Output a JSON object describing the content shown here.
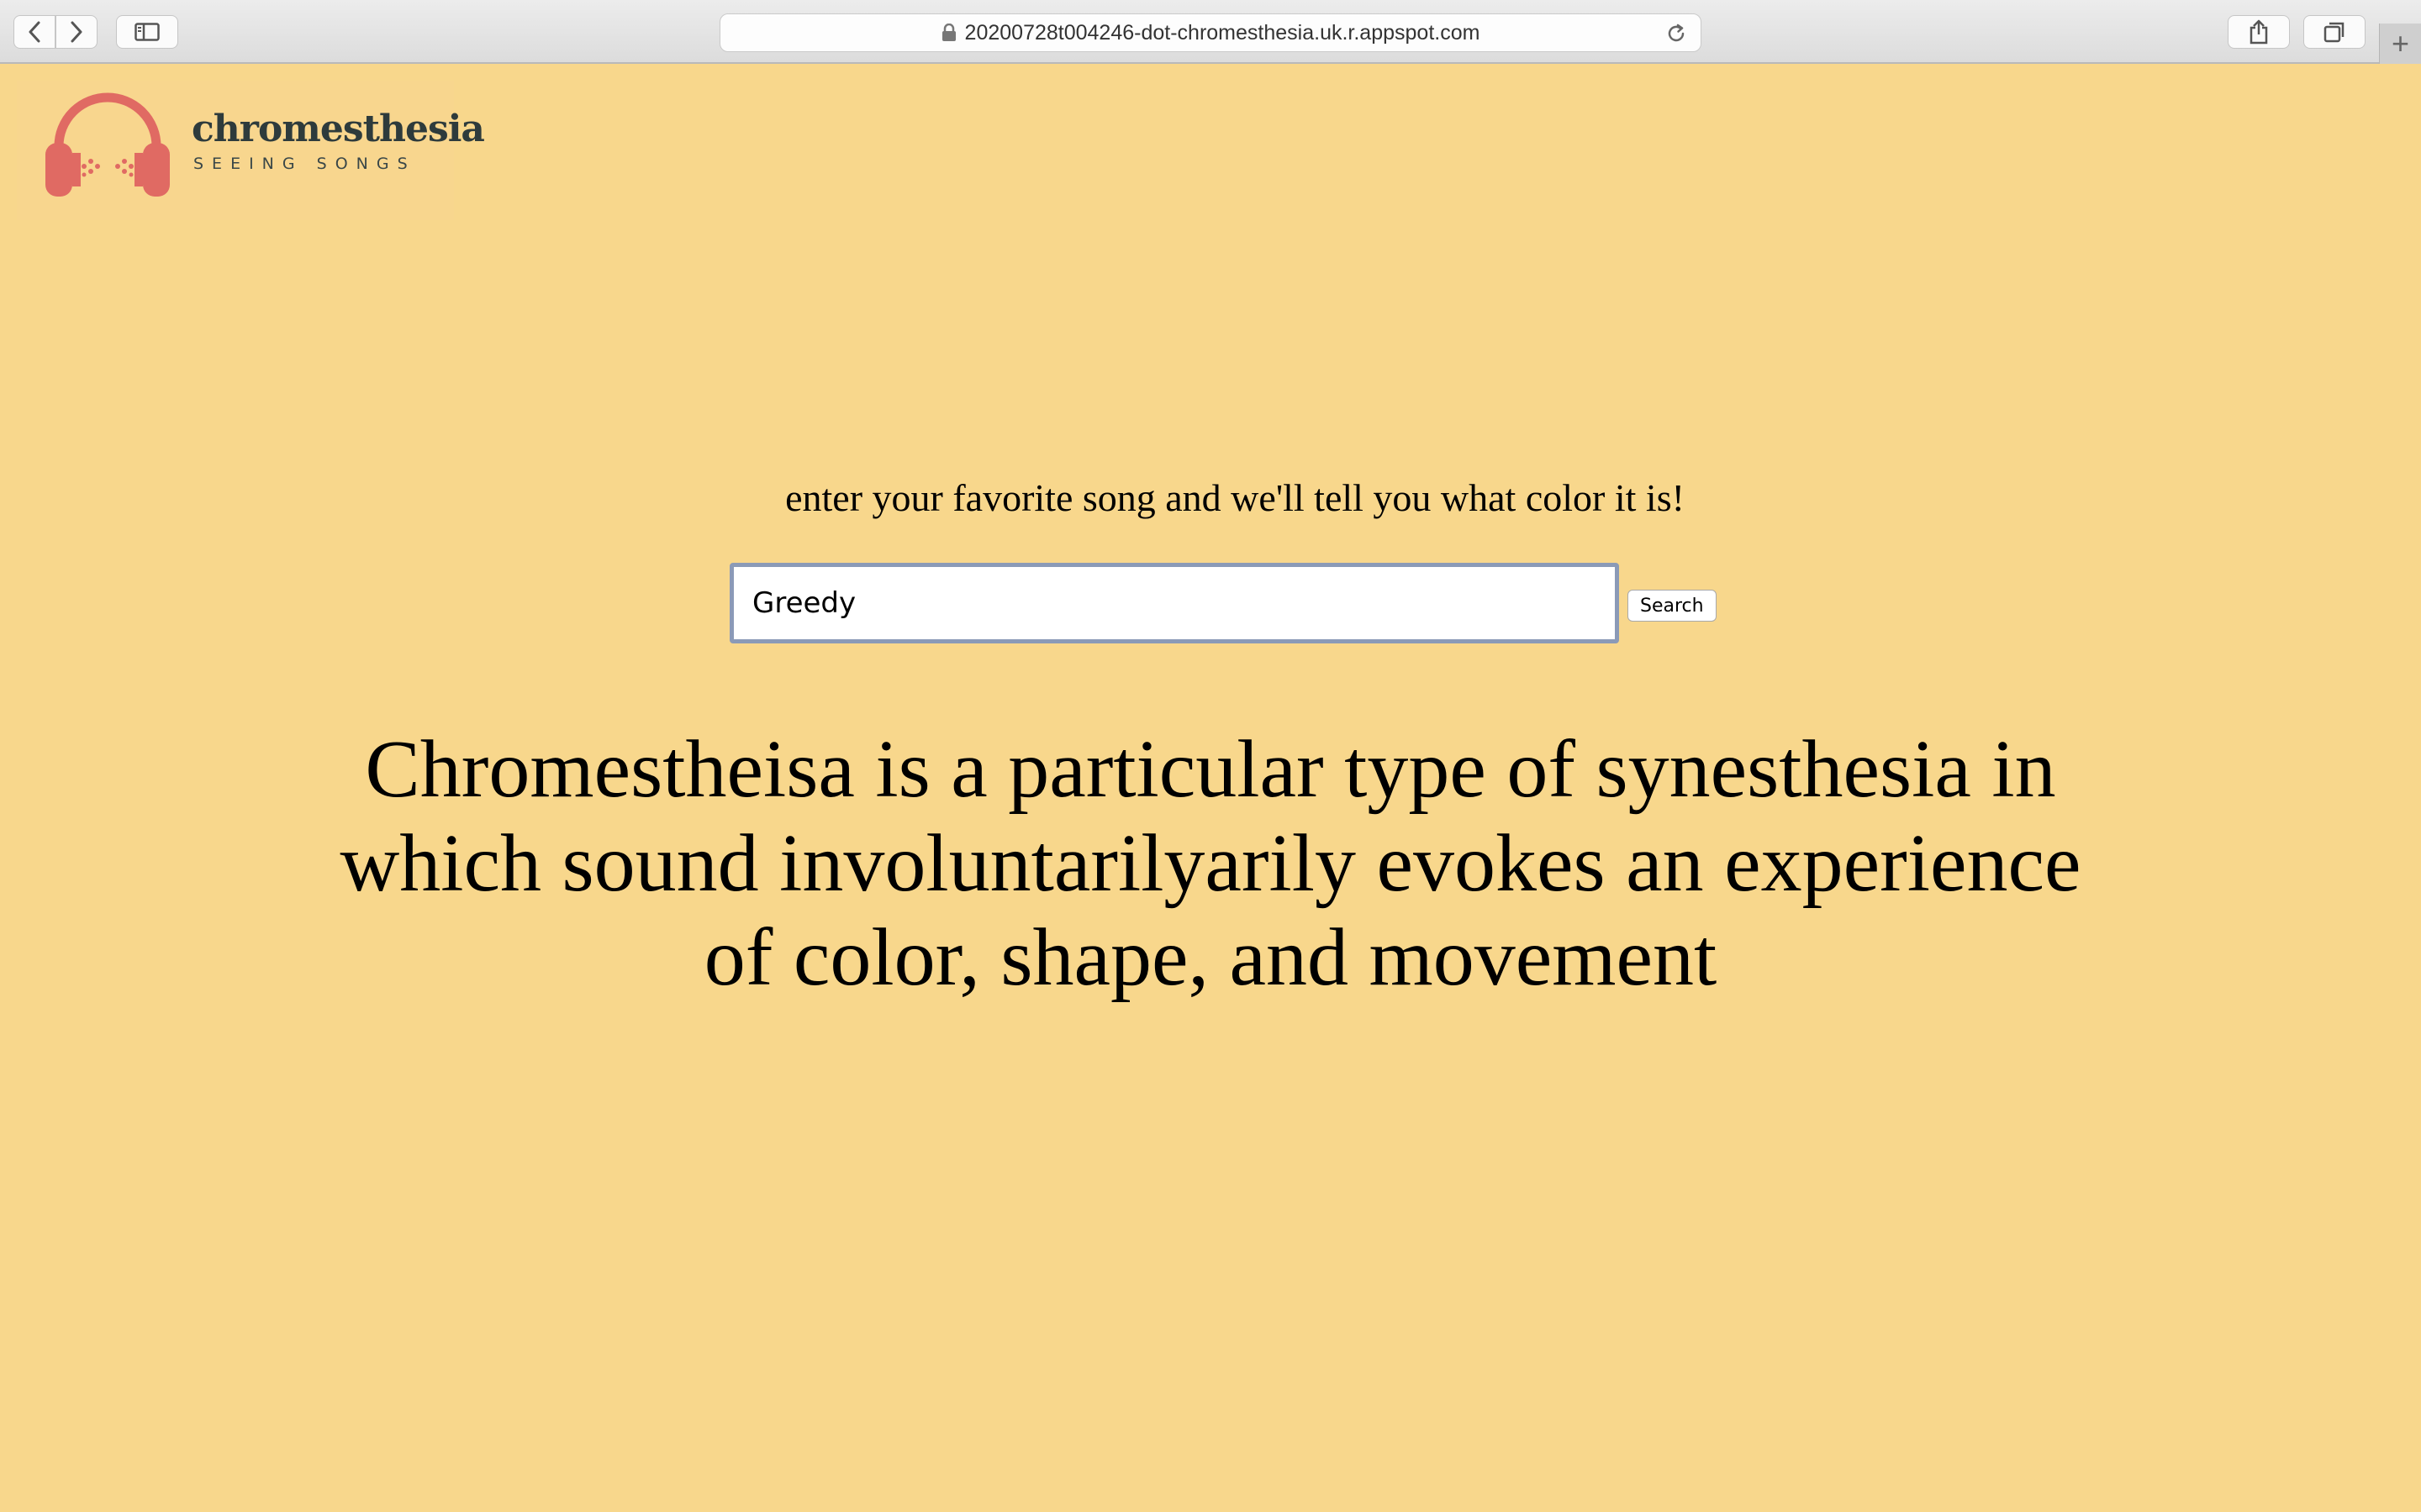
{
  "browser": {
    "url": "20200728t004246-dot-chromesthesia.uk.r.appspot.com",
    "icons": [
      "back-icon",
      "forward-icon",
      "sidebar-icon",
      "lock-icon",
      "reload-icon",
      "share-icon",
      "tabs-icon",
      "plus-icon"
    ],
    "new_tab_label": "+"
  },
  "logo": {
    "name": "chromesthesia",
    "tagline": "SEEING SONGS",
    "icon": "headphones-icon",
    "accent_color": "#e06a63"
  },
  "main": {
    "prompt": "enter your favorite song and we'll tell you what color it is!",
    "search": {
      "value": "Greedy",
      "button_label": "Search"
    },
    "description": "Chromestheisa is a particular type of synesthesia in which sound involuntarilyarily evokes an experience of color, shape, and movement"
  },
  "colors": {
    "background": "#f8d78c",
    "text": "#000000"
  }
}
